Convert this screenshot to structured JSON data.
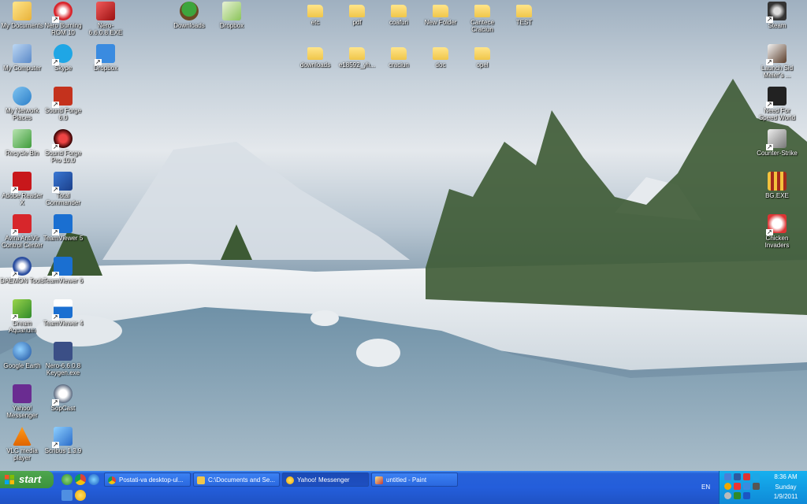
{
  "desktop_icons": {
    "my_documents": "My Documents",
    "nero_burning_rom": "Nero Burning ROM 10",
    "nero_exe": "Nero-6.6.0.8.EXE",
    "downloads_tree": "Downloads",
    "dropbox": "Dropbox",
    "my_computer": "My Computer",
    "skype": "Skype",
    "dropbox2": "Dropbox",
    "my_network_places": "My Network Places",
    "sound_forge_60": "Sound Forge 6.0",
    "recycle_bin": "Recycle Bin",
    "sound_forge_pro_100": "Sound Forge Pro 10.0",
    "adobe_reader": "Adobe Reader X",
    "total_commander": "Total Commander",
    "avira": "Avira AntiVir Control Center",
    "teamviewer5": "TeamViewer 5",
    "daemon_tools": "DAEMON Tools",
    "teamviewer6": "TeamViewer 6",
    "dream_aquarium": "Dream Aquarium",
    "teamviewer4": "TeamViewer 4",
    "google_earth": "Google Earth",
    "nero_keygen": "Nero-6.6.0.8 Keygen.exe",
    "yahoo_messenger": "Yahoo! Messenger",
    "sopcast": "SopCast",
    "vlc": "VLC media player",
    "scribus": "Scribus 1.3.9",
    "steam": "Steam",
    "launch_sid": "Launch Sid Meier's ...",
    "nfs": "Need For Speed World",
    "counter_strike": "Counter-Strike",
    "bg_exe": "BG.EXE",
    "chicken_invaders": "Chicken Invaders"
  },
  "folders": {
    "f1": "etc",
    "f2": "pdf",
    "f3": "coafuri",
    "f4": "New Folder",
    "f5": "Cantece Craciun",
    "f6": "TEST",
    "f7": "downloads",
    "f8": "e18592_yh...",
    "f9": "craciun",
    "f10": "doc",
    "f11": "opel"
  },
  "taskbar": {
    "start_label": "start",
    "tasks": [
      {
        "label": "Postati-va desktop-ul..."
      },
      {
        "label": "C:\\Documents and Se..."
      },
      {
        "label": "Yahoo! Messenger"
      },
      {
        "label": "untitled - Paint"
      }
    ],
    "language": "EN",
    "clock_time": "8:36 AM",
    "clock_day": "Sunday",
    "clock_date": "1/9/2011"
  },
  "colors": {
    "taskbar_blue": "#245edb",
    "start_green": "#3b923b",
    "tray_blue": "#0f8ad7"
  }
}
